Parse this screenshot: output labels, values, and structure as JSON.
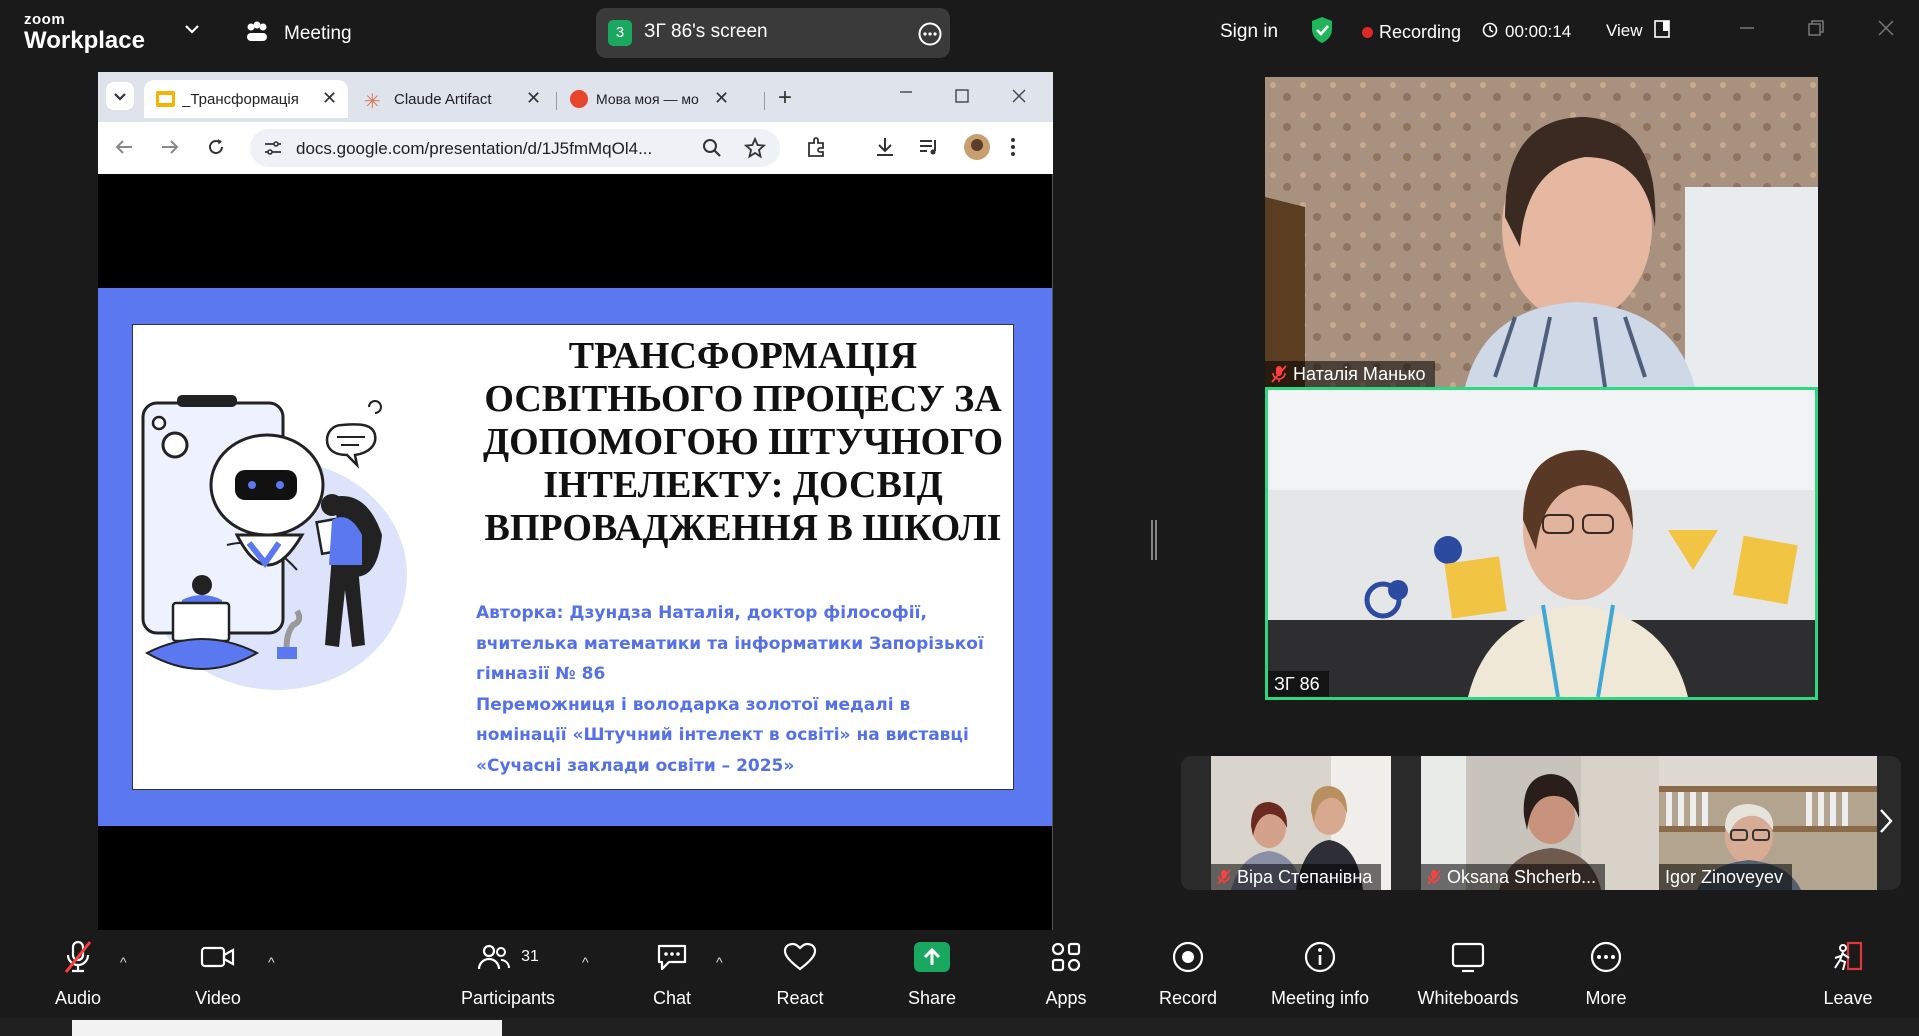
{
  "app": {
    "brand_line1": "zoom",
    "brand_line2": "Workplace",
    "meeting_label": "Meeting"
  },
  "screen_share": {
    "number": "3",
    "label": "ЗГ 86's screen"
  },
  "topbar": {
    "sign_in": "Sign in",
    "recording": "Recording",
    "timer": "00:00:14",
    "view": "View"
  },
  "browser": {
    "tabs": [
      {
        "label": "_Трансформація"
      },
      {
        "label": "Claude Artifact"
      },
      {
        "label": "Мова моя — мо"
      }
    ],
    "url": "docs.google.com/presentation/d/1J5fmMqOl4..."
  },
  "slide": {
    "title": "ТРАНСФОРМАЦІЯ ОСВІТНЬОГО ПРОЦЕСУ ЗА ДОПОМОГОЮ ШТУЧНОГО ІНТЕЛЕКТУ: ДОСВІД ВПРОВАДЖЕННЯ В ШКОЛІ",
    "author": "Авторка: Дзундза Наталія, доктор філософії, вчителька математики та інформатики Запорізької гімназії № 86",
    "award": "Переможниця і володарка золотої медалі в номінації «Штучний інтелект в освіті» на виставці «Сучасні заклади освіти – 2025»"
  },
  "participants_video": [
    {
      "name": "Наталія Манько",
      "muted": true
    },
    {
      "name": "ЗГ 86",
      "muted": false,
      "active_speaker": true
    }
  ],
  "gallery_strip": [
    {
      "name": "Віра Степанівна",
      "muted": true
    },
    {
      "name": "Oksana Shcherb...",
      "muted": true
    },
    {
      "name": "Igor Zinoveyev",
      "muted": false
    }
  ],
  "toolbar": {
    "audio": "Audio",
    "video": "Video",
    "participants": "Participants",
    "participants_count": "31",
    "chat": "Chat",
    "react": "React",
    "share": "Share",
    "apps": "Apps",
    "record": "Record",
    "meeting_info": "Meeting info",
    "whiteboards": "Whiteboards",
    "more": "More",
    "leave": "Leave"
  },
  "colors": {
    "share_green": "#1aa860",
    "active_border": "#2ed880",
    "slide_blue": "#5b78f0",
    "leave_red": "#e0353a"
  }
}
